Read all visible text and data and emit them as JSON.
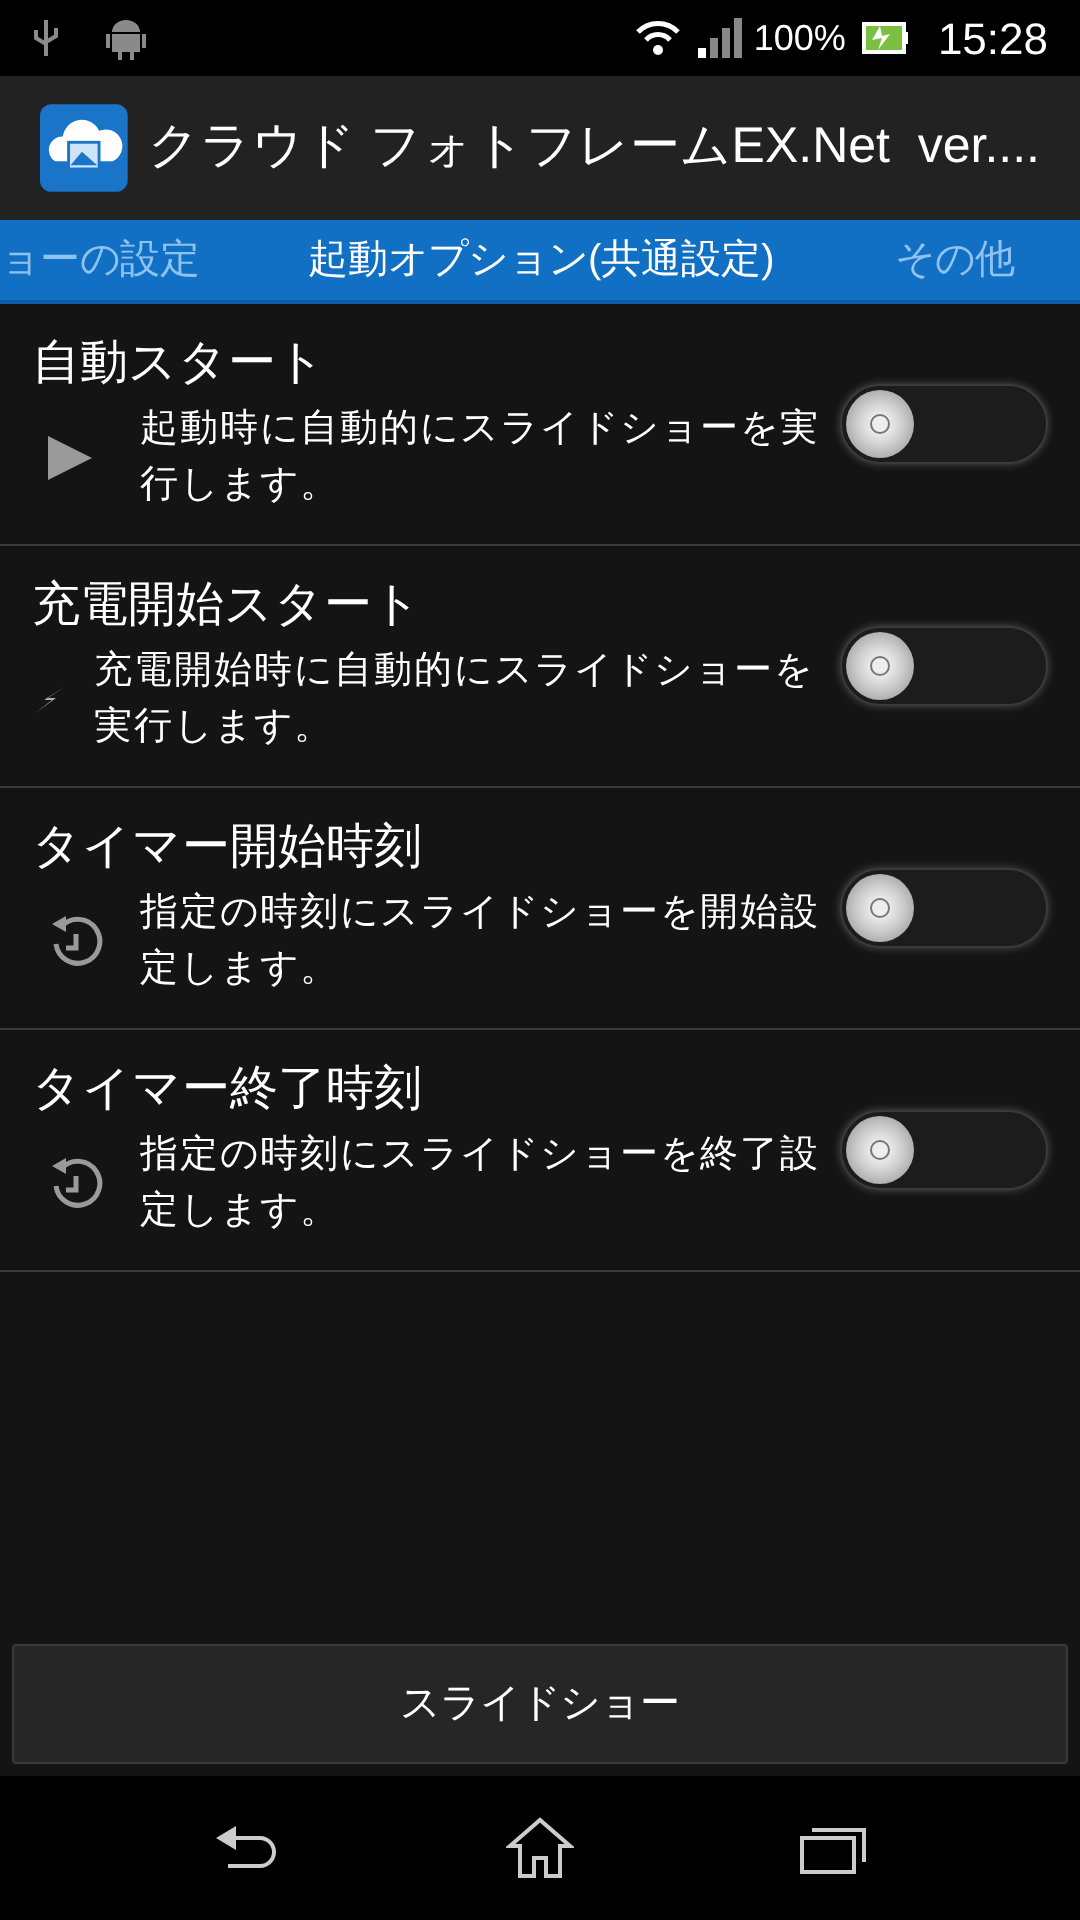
{
  "status_bar": {
    "battery": "100%",
    "time": "15:28"
  },
  "app_bar": {
    "title": "クラウド フォトフレームEX.Net  ver...."
  },
  "tabs": [
    {
      "label": "ョーの設定",
      "selected": false
    },
    {
      "label": "起動オプション(共通設定)",
      "selected": true
    },
    {
      "label": "その他",
      "selected": false
    }
  ],
  "settings": [
    {
      "kind": "play",
      "title": "自動スタート",
      "description": "起動時に自動的にスライドショーを実行します。",
      "on": false
    },
    {
      "kind": "charge",
      "title": "充電開始スタート",
      "description": "充電開始時に自動的にスライドショーを実行します。",
      "on": false
    },
    {
      "kind": "timer",
      "title": "タイマー開始時刻",
      "description": "指定の時刻にスライドショーを開始設定します。",
      "on": false
    },
    {
      "kind": "timer",
      "title": "タイマー終了時刻",
      "description": "指定の時刻にスライドショーを終了設定します。",
      "on": false
    }
  ],
  "button": "スライドショー"
}
